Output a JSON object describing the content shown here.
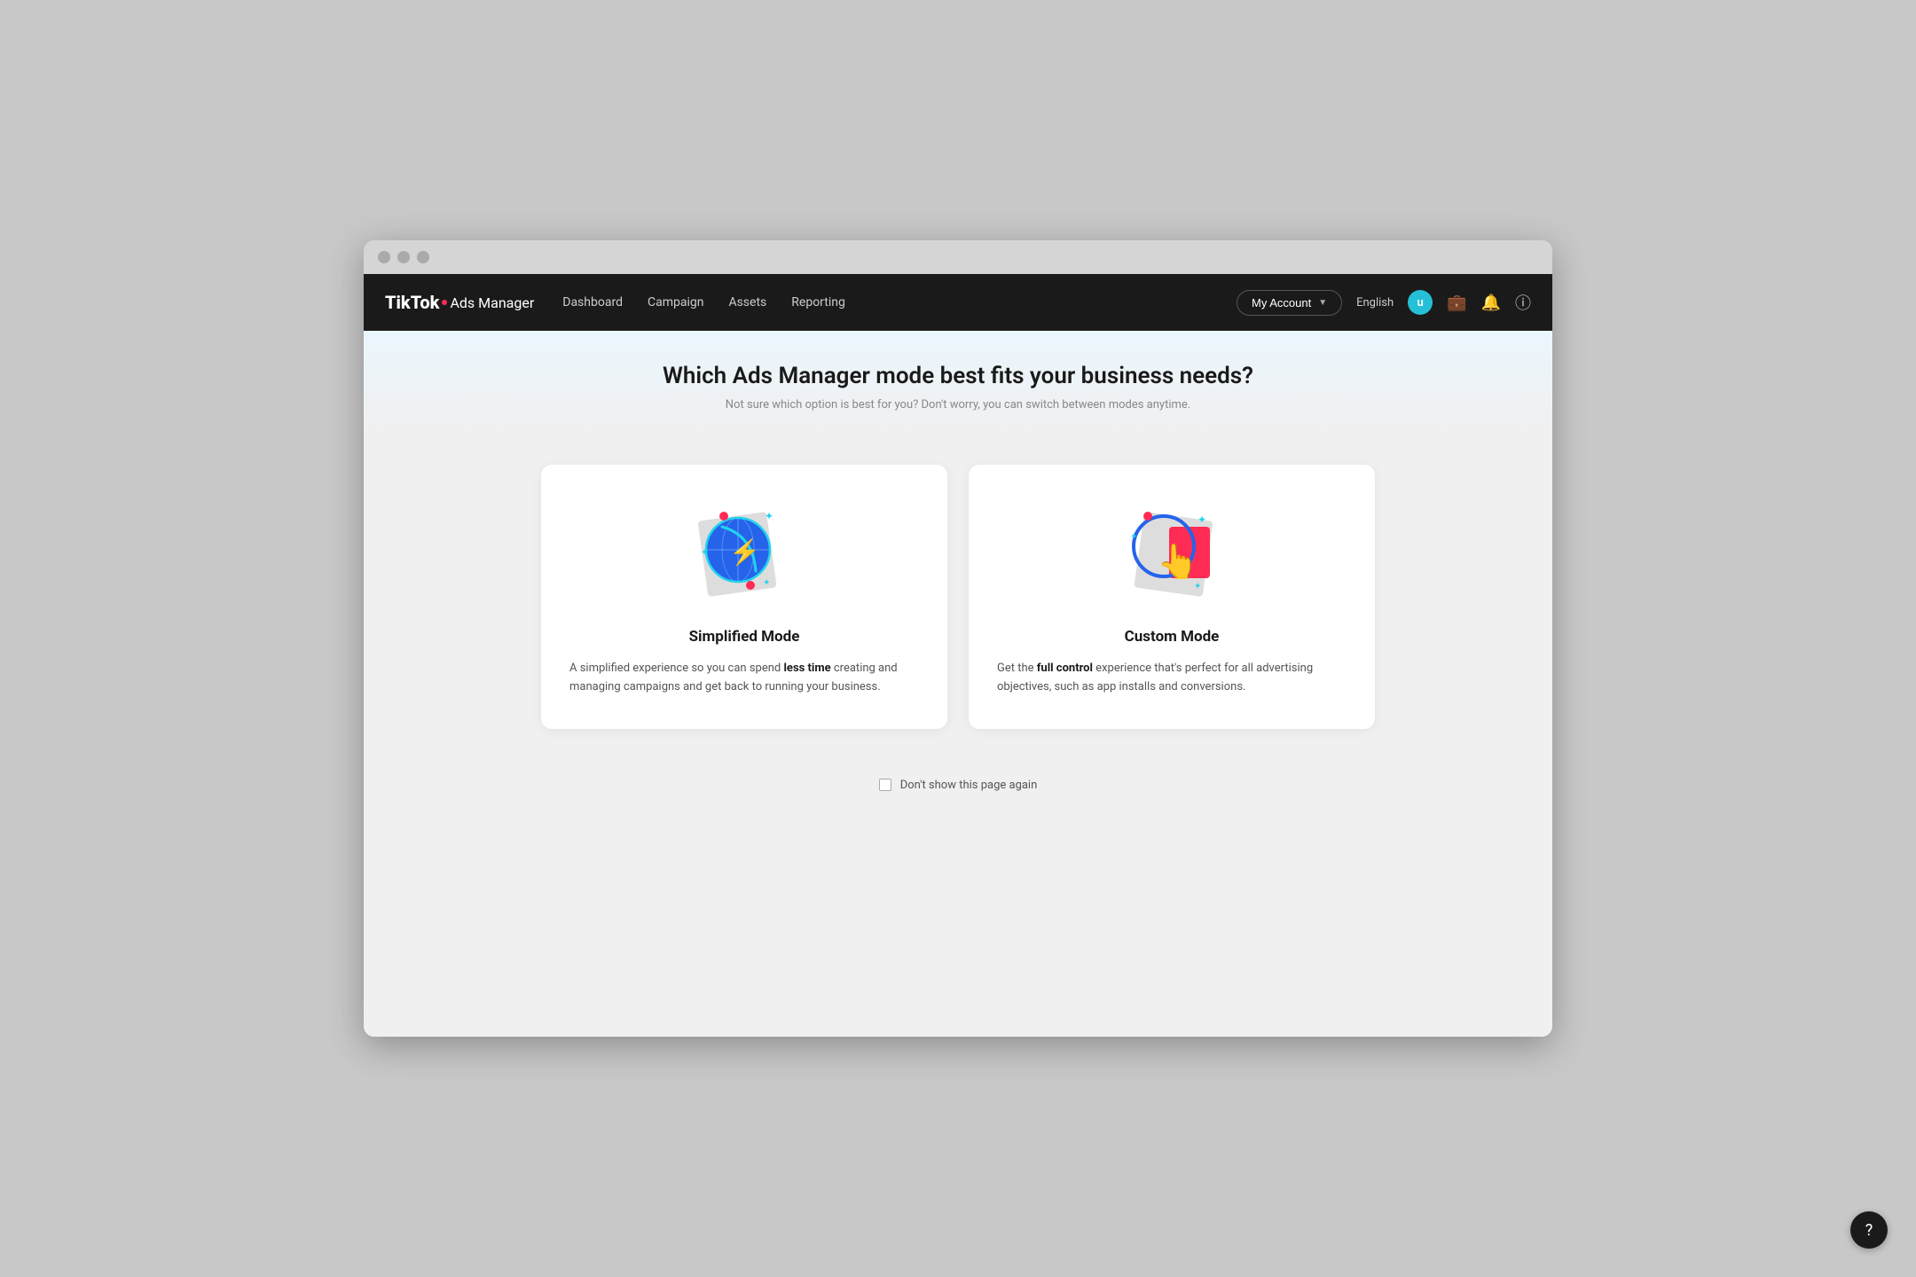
{
  "browser": {
    "dots": [
      "dot1",
      "dot2",
      "dot3"
    ]
  },
  "navbar": {
    "brand": "TikTok",
    "brand_sub": "Ads Manager",
    "links": [
      {
        "id": "dashboard",
        "label": "Dashboard"
      },
      {
        "id": "campaign",
        "label": "Campaign"
      },
      {
        "id": "assets",
        "label": "Assets"
      },
      {
        "id": "reporting",
        "label": "Reporting"
      }
    ],
    "my_account_label": "My Account",
    "language": "English",
    "avatar_letter": "u",
    "icons": {
      "briefcase": "💼",
      "bell": "🔔",
      "help": "?"
    }
  },
  "hero": {
    "title": "Which Ads Manager mode best fits your business needs?",
    "subtitle": "Not sure which option is best for you? Don't worry, you can switch between modes anytime."
  },
  "cards": [
    {
      "id": "simplified",
      "title": "Simplified Mode",
      "desc_before_bold": "A simplified experience so you can spend ",
      "bold_text": "less time",
      "desc_after_bold": " creating and managing campaigns and get back to running your business."
    },
    {
      "id": "custom",
      "title": "Custom Mode",
      "desc_before_bold": "Get the ",
      "bold_text": "full control",
      "desc_after_bold": " experience that's perfect for all advertising objectives, such as app installs and conversions."
    }
  ],
  "checkbox": {
    "label": "Don't show this page again"
  },
  "floating_help": {
    "icon": "?"
  }
}
